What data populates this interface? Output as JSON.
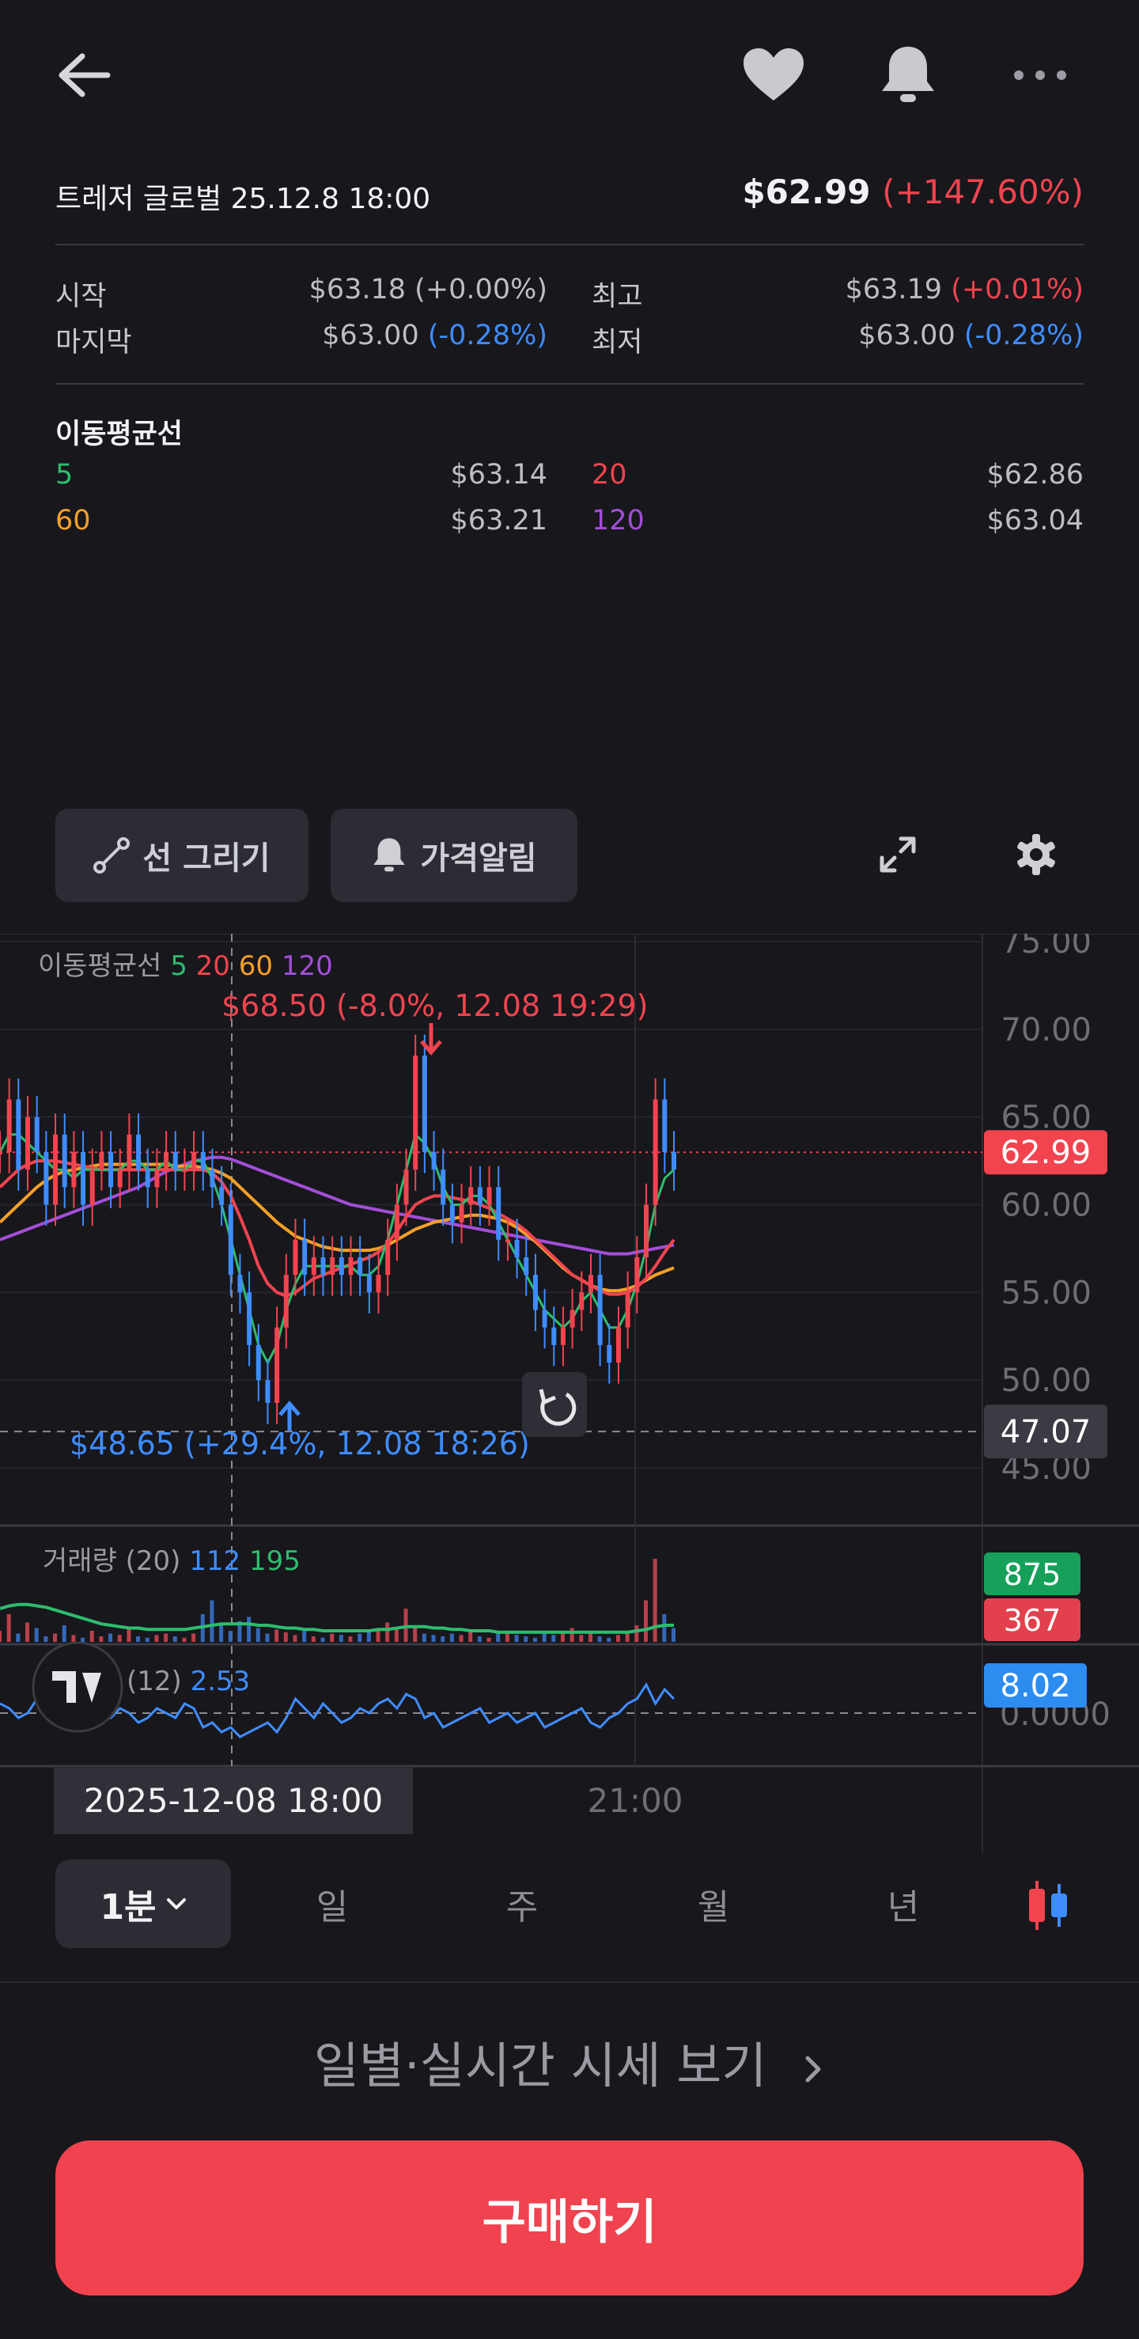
{
  "header": {
    "title": "트레저 글로벌 25.12.8 18:00",
    "price": "$62.99",
    "change": "(+147.60%)"
  },
  "ohlc": {
    "open_label": "시작",
    "open_value": "$63.18",
    "open_change": "(+0.00%)",
    "high_label": "최고",
    "high_value": "$63.19",
    "high_change": "(+0.01%)",
    "close_label": "마지막",
    "close_value": "$63.00",
    "close_change": "(-0.28%)",
    "low_label": "최저",
    "low_value": "$63.00",
    "low_change": "(-0.28%)"
  },
  "moving_averages": {
    "title": "이동평균선",
    "items": [
      {
        "period": "5",
        "value": "$63.14",
        "color": "#2dbd6e"
      },
      {
        "period": "20",
        "value": "$62.86",
        "color": "#f1444f"
      },
      {
        "period": "60",
        "value": "$63.21",
        "color": "#f5a028"
      },
      {
        "period": "120",
        "value": "$63.04",
        "color": "#a34ed8"
      }
    ]
  },
  "toolbar": {
    "draw_line_label": "선 그리기",
    "price_alert_label": "가격알림"
  },
  "chart_data": {
    "type": "line",
    "title": "",
    "legend_label": "이동평균선",
    "legend_periods": [
      "5",
      "20",
      "60",
      "120"
    ],
    "y_ticks": [
      "75.00",
      "70.00",
      "65.00",
      "60.00",
      "55.00",
      "50.00",
      "45.00"
    ],
    "ylim": [
      45,
      75
    ],
    "x_ticks": [
      "2025-12-08  18:00",
      "21:00"
    ],
    "current_price_badge": "62.99",
    "crosshair_price_badge": "47.07",
    "high_annotation": "$68.50 (-8.0%, 12.08 19:29)",
    "low_annotation": "$48.65 (+29.4%, 12.08 18:26)",
    "price": [
      63,
      66,
      62,
      65,
      63,
      60,
      64,
      61,
      63,
      60,
      62,
      63,
      61,
      62,
      64,
      62,
      61,
      62,
      63,
      62,
      62,
      63,
      62,
      61,
      60,
      56,
      55,
      52,
      50,
      48.7,
      53,
      56,
      58,
      56,
      57,
      56,
      57,
      56,
      57,
      56,
      55,
      56,
      58,
      60,
      62,
      68.5,
      63,
      62,
      60,
      59,
      60,
      61,
      60,
      61,
      58,
      58,
      57,
      56,
      54,
      53,
      52,
      53,
      54,
      55,
      56,
      52,
      51,
      53,
      55,
      57,
      60,
      66,
      63,
      62
    ],
    "ma5": [
      63,
      64,
      64,
      63.5,
      63,
      62.5,
      62,
      62,
      61.5,
      62,
      62,
      62,
      62,
      62,
      62.5,
      62.5,
      62,
      62,
      62.5,
      62,
      62,
      62.5,
      62.5,
      61.5,
      60,
      58,
      56,
      54,
      52,
      51,
      52,
      54,
      55.5,
      56.5,
      56.5,
      56.5,
      56.5,
      56.5,
      56.5,
      56,
      56,
      56.5,
      58,
      60,
      62,
      64,
      63.5,
      62.5,
      61,
      60,
      60,
      60.5,
      60.5,
      60,
      59,
      58,
      57,
      56,
      55,
      54,
      53.5,
      53,
      53.5,
      54.5,
      55,
      54,
      53,
      53,
      54,
      55.5,
      57.5,
      60,
      61.5,
      62
    ],
    "ma20": [
      61,
      61.5,
      62,
      62.3,
      62.5,
      62.5,
      62.5,
      62.4,
      62.3,
      62.2,
      62.1,
      62,
      62,
      62,
      62,
      62,
      62,
      62,
      62,
      62,
      62,
      62,
      62,
      61.8,
      61.3,
      60.5,
      59.3,
      58,
      56.5,
      55.5,
      55,
      54.8,
      55,
      55.4,
      55.8,
      56,
      56.2,
      56.4,
      56.6,
      56.8,
      57,
      57.3,
      57.8,
      58.5,
      59.3,
      60,
      60.3,
      60.5,
      60.5,
      60.4,
      60.3,
      60.2,
      60,
      59.8,
      59.5,
      59.2,
      58.9,
      58.5,
      58,
      57.5,
      57,
      56.5,
      56,
      55.7,
      55.4,
      55.1,
      54.9,
      54.9,
      55,
      55.3,
      55.8,
      56.5,
      57.3,
      58
    ],
    "ma60": [
      59,
      59.5,
      60,
      60.5,
      61,
      61.4,
      61.7,
      61.9,
      62,
      62.1,
      62.2,
      62.3,
      62.3,
      62.3,
      62.3,
      62.3,
      62.3,
      62.3,
      62.3,
      62.2,
      62.2,
      62.2,
      62.1,
      62,
      61.8,
      61.5,
      61,
      60.5,
      60,
      59.5,
      59,
      58.6,
      58.2,
      58,
      57.8,
      57.6,
      57.5,
      57.4,
      57.4,
      57.4,
      57.4,
      57.5,
      57.7,
      58,
      58.3,
      58.6,
      58.8,
      59,
      59.1,
      59.2,
      59.3,
      59.4,
      59.4,
      59.3,
      59.2,
      59,
      58.7,
      58.3,
      57.9,
      57.4,
      56.9,
      56.4,
      56,
      55.7,
      55.4,
      55.2,
      55.1,
      55.1,
      55.2,
      55.4,
      55.7,
      56,
      56.2,
      56.4
    ],
    "ma120": [
      58,
      58.2,
      58.4,
      58.6,
      58.8,
      59,
      59.2,
      59.4,
      59.6,
      59.8,
      60,
      60.2,
      60.4,
      60.6,
      60.8,
      61,
      61.3,
      61.6,
      61.9,
      62.1,
      62.3,
      62.5,
      62.6,
      62.7,
      62.7,
      62.6,
      62.4,
      62.2,
      62,
      61.8,
      61.6,
      61.4,
      61.2,
      61,
      60.8,
      60.6,
      60.4,
      60.2,
      60,
      59.9,
      59.8,
      59.7,
      59.6,
      59.5,
      59.4,
      59.3,
      59.2,
      59.1,
      59,
      58.9,
      58.8,
      58.7,
      58.6,
      58.5,
      58.4,
      58.3,
      58.2,
      58.1,
      58,
      57.9,
      57.8,
      57.7,
      57.6,
      57.5,
      57.4,
      57.3,
      57.2,
      57.2,
      57.2,
      57.3,
      57.4,
      57.5,
      57.6,
      57.7
    ],
    "volume_panel": {
      "label": "거래량 (20)",
      "value_a": "112",
      "value_b": "195",
      "badge_green": "875",
      "badge_red": "367",
      "bars": [
        8,
        20,
        6,
        14,
        10,
        4,
        6,
        12,
        5,
        3,
        8,
        4,
        6,
        5,
        10,
        4,
        3,
        5,
        6,
        4,
        3,
        6,
        20,
        30,
        12,
        8,
        15,
        18,
        10,
        6,
        9,
        7,
        5,
        8,
        4,
        3,
        6,
        5,
        4,
        6,
        8,
        10,
        14,
        9,
        24,
        12,
        6,
        5,
        4,
        6,
        5,
        8,
        4,
        3,
        6,
        7,
        5,
        4,
        3,
        6,
        5,
        8,
        10,
        5,
        6,
        4,
        3,
        5,
        7,
        12,
        30,
        60,
        20,
        10
      ],
      "ma": [
        24,
        26,
        27,
        27,
        26,
        25,
        23,
        21,
        19,
        17,
        15,
        13,
        12,
        11,
        10,
        10,
        9,
        9,
        9,
        9,
        9,
        10,
        11,
        12,
        13,
        13,
        13,
        13,
        12,
        12,
        11,
        10,
        10,
        9,
        9,
        8,
        8,
        8,
        8,
        8,
        8,
        9,
        9,
        10,
        11,
        11,
        11,
        10,
        10,
        9,
        9,
        8,
        8,
        8,
        7,
        7,
        7,
        7,
        7,
        7,
        7,
        7,
        7,
        7,
        7,
        7,
        7,
        7,
        7,
        8,
        9,
        11,
        12,
        12
      ]
    },
    "oscillator_panel": {
      "label": "(12)",
      "value": "2.53",
      "badge": "8.02",
      "zero_tick": "0.0000",
      "values": [
        2,
        1,
        -1,
        0,
        3,
        1,
        -2,
        0,
        1,
        -1,
        2,
        0,
        -1,
        1,
        0,
        -2,
        -1,
        1,
        0,
        -1,
        2,
        1,
        -3,
        -2,
        -4,
        -3,
        -5,
        -4,
        -3,
        -2,
        -4,
        -1,
        3,
        1,
        -1,
        2,
        0,
        -2,
        -1,
        1,
        0,
        2,
        3,
        1,
        4,
        3,
        -1,
        0,
        -3,
        -2,
        -1,
        0,
        1,
        -2,
        -1,
        0,
        -2,
        -1,
        0,
        -3,
        -2,
        -1,
        0,
        1,
        -2,
        -3,
        -1,
        0,
        2,
        3,
        6,
        2,
        5,
        3
      ]
    }
  },
  "periods": {
    "selected": "1분",
    "tabs": [
      "일",
      "주",
      "월",
      "년"
    ]
  },
  "quote_link": "일별·실시간 시세 보기",
  "buy_button": "구매하기",
  "colors": {
    "up": "#f1444f",
    "down": "#3f8cff",
    "background": "#17171c"
  }
}
